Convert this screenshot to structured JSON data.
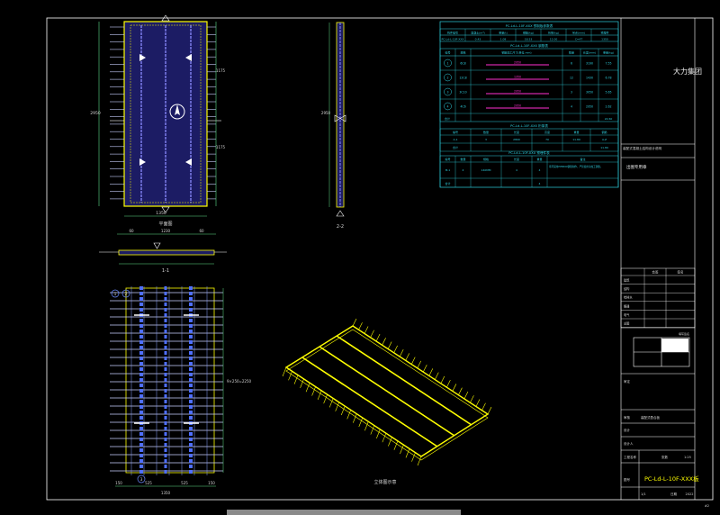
{
  "drawing": {
    "plan_title": "平面图",
    "rebar_title": "配筋图",
    "iso_title": "立体图示意",
    "section_1": "1-1",
    "section_2": "2-2",
    "plan_dim_width": "1350",
    "plan_dim_height": "2950",
    "plan_dims_side": [
      "300",
      "1175",
      "1175",
      "300"
    ],
    "section1_dims": [
      "60",
      "1230",
      "60"
    ],
    "rebar_dim": "1350",
    "rebar_bottom_dims": [
      "150",
      "525",
      "525",
      "150"
    ],
    "rebar_side_dims": [
      "150",
      "9×250=2250",
      "150"
    ],
    "section2_dims": [
      "60",
      "2950",
      "60"
    ],
    "rebar_tags": [
      "1",
      "2",
      "3",
      "4"
    ]
  },
  "tables": {
    "table1_title": "PC-Ld-L-10F-XXX 预制板参数表",
    "table1_headers": [
      "构件编号",
      "混凝土(m³)",
      "重量(t)",
      "钢筋(kg)",
      "桁架(kg)",
      "吊点(mm)",
      "预埋件"
    ],
    "table1_row": [
      "PC-Ld-L-10F-XXX",
      "0.43",
      "1.08",
      "18.53",
      "12.00",
      "C=4T",
      "1350"
    ],
    "table2_title": "PC-Ld-L-10F-XXX 钢筋表",
    "table2_headers": [
      "编号",
      "规格",
      "钢筋加工尺寸(单位:mm)",
      "数量",
      "长度(mm)",
      "重量(kg)"
    ],
    "table2_rows": [
      {
        "no": "1",
        "spec": "6C8",
        "shape": "2950",
        "qty": "6",
        "len": "3190",
        "wt": "7.55"
      },
      {
        "no": "2",
        "spec": "12C8",
        "shape": "1350",
        "qty": "12",
        "len": "1430",
        "wt": "6.78"
      },
      {
        "no": "3",
        "spec": "3C10",
        "shape": "2950",
        "qty": "3",
        "len": "3050",
        "wt": "5.65"
      },
      {
        "no": "4",
        "spec": "4C6",
        "shape": "2950",
        "qty": "4",
        "len": "2950",
        "wt": "2.62"
      }
    ],
    "table2_total_label": "合计",
    "table2_total": "22.60",
    "table3_title": "PC-Ld-L-10F-XXX 桁架表",
    "table3_headers": [
      "编号",
      "数量",
      "长度",
      "高度",
      "重量",
      "钢筋"
    ],
    "table3_rows": [
      [
        "A-1",
        "3",
        "2800",
        "70",
        "11.89",
        "A-Z"
      ],
      [
        "合计",
        "",
        "",
        "",
        "",
        "11.89"
      ]
    ],
    "table4_title": "PC-Ld-L-10F-XXX 预埋件表",
    "table4_headers": [
      "编号",
      "数量",
      "规格",
      "长度",
      "重量",
      "备注"
    ],
    "table4_rows": [
      [
        "M-1",
        "4",
        "140MM",
        "4",
        "4",
        "吊环采用HPB300钢筋制作，严禁使用冷加工钢筋。"
      ],
      [
        "合计",
        "",
        "",
        "",
        "4",
        ""
      ]
    ]
  },
  "title_block": {
    "company": "大力集团",
    "project_note": "装配式混凝土结构设计说明",
    "stamp": "出图专用章",
    "sign_header": [
      "会签",
      "签名"
    ],
    "sign_rows": [
      "建筑",
      "结构",
      "给排水",
      "暖通",
      "电气",
      "总图"
    ],
    "fill_label": "填写签名",
    "approved": "审定",
    "checked": "审核",
    "designer": "设计",
    "designed_by": "设计人",
    "project": "工程名称",
    "drawing_name": "装配式叠合板",
    "drawing_no": "图号",
    "drawing_code": "PC-Ld-L-10F-XXX板",
    "scale_label": "比例",
    "scale_value": "1:25",
    "date_label": "日期",
    "date_value": "2022",
    "sheet_label": "张数",
    "sheet_value": "1/1",
    "page_no": "#2"
  },
  "colors": {
    "background": "#000000",
    "frame": "#ffffff",
    "table_line": "#2fd0e0",
    "slab_fill": "#2a2a8a",
    "rebar": "#4f6fff",
    "highlight": "#ffff00",
    "magenta": "#ff2fd0",
    "dim": "#5fe08a",
    "white_stripe": "#d0d8ff"
  }
}
